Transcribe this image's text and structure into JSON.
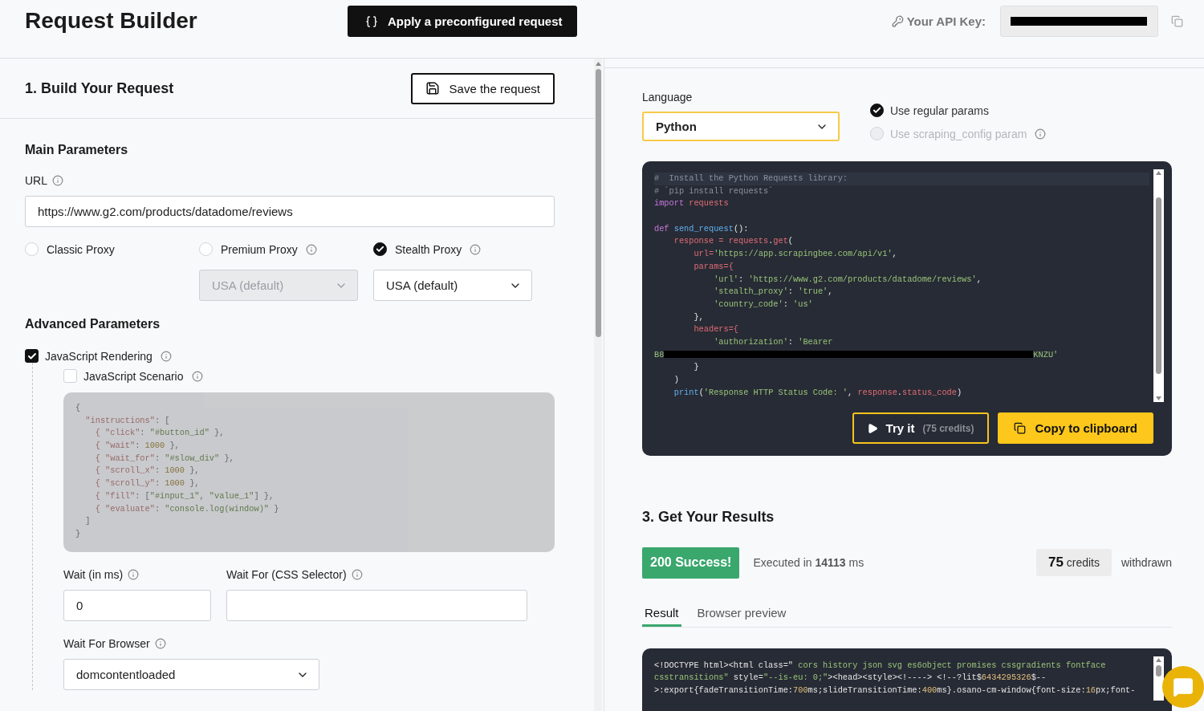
{
  "header": {
    "title": "Request Builder",
    "preset_button": "Apply a preconfigured request",
    "api_key_label": "Your API Key:"
  },
  "build": {
    "title": "1. Build Your Request",
    "save_button": "Save the request",
    "main": {
      "title": "Main Parameters",
      "url_label": "URL",
      "url_value": "https://www.g2.com/products/datadome/reviews",
      "proxies": [
        {
          "label": "Classic Proxy",
          "selected": false,
          "info": false
        },
        {
          "label": "Premium Proxy",
          "selected": false,
          "info": true,
          "country": "USA (default)"
        },
        {
          "label": "Stealth Proxy",
          "selected": true,
          "info": true,
          "country": "USA (default)"
        }
      ]
    },
    "advanced": {
      "title": "Advanced Parameters",
      "js_rendering": {
        "label": "JavaScript Rendering",
        "checked": true
      },
      "js_scenario": {
        "label": "JavaScript Scenario",
        "checked": false
      },
      "scenario_code": [
        {
          "kind": "code",
          "tokens": [
            {
              "text": "{",
              "kind": "plain"
            }
          ]
        },
        {
          "kind": "code",
          "tokens": [
            {
              "text": "  \"instructions\"",
              "kind": "key"
            },
            {
              "text": ": [",
              "kind": "plain"
            }
          ]
        },
        {
          "kind": "code",
          "tokens": [
            {
              "text": "    { \"click\"",
              "kind": "key"
            },
            {
              "text": ": ",
              "kind": "plain"
            },
            {
              "text": "\"#button_id\"",
              "kind": "string"
            },
            {
              "text": " },",
              "kind": "plain"
            }
          ]
        },
        {
          "kind": "code",
          "tokens": [
            {
              "text": "    { \"wait\"",
              "kind": "key"
            },
            {
              "text": ": ",
              "kind": "plain"
            },
            {
              "text": "1000",
              "kind": "number"
            },
            {
              "text": " },",
              "kind": "plain"
            }
          ]
        },
        {
          "kind": "code",
          "tokens": [
            {
              "text": "    { \"wait_for\"",
              "kind": "key"
            },
            {
              "text": ": ",
              "kind": "plain"
            },
            {
              "text": "\"#slow_div\"",
              "kind": "string"
            },
            {
              "text": " },",
              "kind": "plain"
            }
          ]
        },
        {
          "kind": "code",
          "tokens": [
            {
              "text": "    { \"scroll_x\"",
              "kind": "key"
            },
            {
              "text": ": ",
              "kind": "plain"
            },
            {
              "text": "1000",
              "kind": "number"
            },
            {
              "text": " },",
              "kind": "plain"
            }
          ]
        },
        {
          "kind": "code",
          "tokens": [
            {
              "text": "    { \"scroll_y\"",
              "kind": "key"
            },
            {
              "text": ": ",
              "kind": "plain"
            },
            {
              "text": "1000",
              "kind": "number"
            },
            {
              "text": " },",
              "kind": "plain"
            }
          ]
        },
        {
          "kind": "code",
          "tokens": [
            {
              "text": "    { \"fill\"",
              "kind": "key"
            },
            {
              "text": ": [",
              "kind": "plain"
            },
            {
              "text": "\"#input_1\"",
              "kind": "string"
            },
            {
              "text": ", ",
              "kind": "plain"
            },
            {
              "text": "\"value_1\"",
              "kind": "string"
            },
            {
              "text": "] },",
              "kind": "plain"
            }
          ]
        },
        {
          "kind": "code",
          "tokens": [
            {
              "text": "    { \"evaluate\"",
              "kind": "key"
            },
            {
              "text": ": ",
              "kind": "plain"
            },
            {
              "text": "\"console.log(window)\"",
              "kind": "string"
            },
            {
              "text": " }",
              "kind": "plain"
            }
          ]
        },
        {
          "kind": "code",
          "tokens": [
            {
              "text": "  ]",
              "kind": "plain"
            }
          ]
        },
        {
          "kind": "code",
          "tokens": [
            {
              "text": "}",
              "kind": "plain"
            }
          ]
        }
      ],
      "wait": {
        "label": "Wait (in ms)",
        "value": "0"
      },
      "wait_for": {
        "label": "Wait For (CSS Selector)"
      },
      "wait_for_browser": {
        "label": "Wait For Browser",
        "value": "domcontentloaded"
      }
    }
  },
  "code": {
    "language_label": "Language",
    "language": "Python",
    "param_modes": [
      {
        "label": "Use regular params",
        "selected": true,
        "disabled": false,
        "info": false
      },
      {
        "label": "Use scraping_config param",
        "selected": false,
        "disabled": true,
        "info": true
      }
    ],
    "lines": [
      {
        "kind": "code",
        "tokens": [
          {
            "text": "#  Install the Python Requests library:",
            "kind": "comment"
          }
        ]
      },
      {
        "kind": "code",
        "tokens": [
          {
            "text": "# `pip install requests`",
            "kind": "comment"
          }
        ]
      },
      {
        "kind": "code",
        "tokens": [
          {
            "text": "import",
            "kind": "keyword"
          },
          {
            "text": " requests",
            "kind": "variable"
          }
        ]
      },
      {
        "kind": "blank"
      },
      {
        "kind": "code",
        "tokens": [
          {
            "text": "def",
            "kind": "keyword"
          },
          {
            "text": " send_request",
            "kind": "function"
          },
          {
            "text": "():",
            "kind": "plain"
          }
        ]
      },
      {
        "kind": "code",
        "tokens": [
          {
            "text": "    response = requests",
            "kind": "variable"
          },
          {
            "text": ".",
            "kind": "plain"
          },
          {
            "text": "get",
            "kind": "variable"
          },
          {
            "text": "(",
            "kind": "plain"
          }
        ]
      },
      {
        "kind": "code",
        "tokens": [
          {
            "text": "        url=",
            "kind": "variable"
          },
          {
            "text": "'https://app.scrapingbee.com/api/v1'",
            "kind": "string"
          },
          {
            "text": ",",
            "kind": "plain"
          }
        ]
      },
      {
        "kind": "code",
        "tokens": [
          {
            "text": "        params={",
            "kind": "variable"
          }
        ]
      },
      {
        "kind": "code",
        "tokens": [
          {
            "text": "            'url'",
            "kind": "string"
          },
          {
            "text": ": ",
            "kind": "plain"
          },
          {
            "text": "'https://www.g2.com/products/datadome/reviews'",
            "kind": "string"
          },
          {
            "text": ",",
            "kind": "plain"
          }
        ]
      },
      {
        "kind": "code",
        "tokens": [
          {
            "text": "            'stealth_proxy'",
            "kind": "string"
          },
          {
            "text": ": ",
            "kind": "plain"
          },
          {
            "text": "'true'",
            "kind": "string"
          },
          {
            "text": ",",
            "kind": "plain"
          }
        ]
      },
      {
        "kind": "code",
        "tokens": [
          {
            "text": "            'country_code'",
            "kind": "string"
          },
          {
            "text": ": ",
            "kind": "plain"
          },
          {
            "text": "'us'",
            "kind": "string"
          }
        ]
      },
      {
        "kind": "code",
        "tokens": [
          {
            "text": "        },",
            "kind": "plain"
          }
        ]
      },
      {
        "kind": "code",
        "tokens": [
          {
            "text": "        headers={",
            "kind": "variable"
          }
        ]
      },
      {
        "kind": "code",
        "tokens": [
          {
            "text": "            'authorization'",
            "kind": "string"
          },
          {
            "text": ": ",
            "kind": "plain"
          },
          {
            "text": "'Bearer",
            "kind": "string"
          }
        ]
      },
      {
        "kind": "code",
        "tokens": [
          {
            "text": "B8",
            "kind": "string"
          },
          {
            "kind": "redacted"
          },
          {
            "text": "KNZU'",
            "kind": "string"
          }
        ]
      },
      {
        "kind": "code",
        "tokens": [
          {
            "text": "        }",
            "kind": "plain"
          }
        ]
      },
      {
        "kind": "code",
        "tokens": [
          {
            "text": "    )",
            "kind": "plain"
          }
        ]
      },
      {
        "kind": "code",
        "tokens": [
          {
            "text": "    print",
            "kind": "function"
          },
          {
            "text": "(",
            "kind": "plain"
          },
          {
            "text": "'Response HTTP Status Code: '",
            "kind": "string"
          },
          {
            "text": ", ",
            "kind": "plain"
          },
          {
            "text": "response",
            "kind": "variable"
          },
          {
            "text": ".",
            "kind": "plain"
          },
          {
            "text": "status_code",
            "kind": "variable"
          },
          {
            "text": ")",
            "kind": "plain"
          }
        ]
      }
    ],
    "try_button": {
      "label": "Try it",
      "credits": "(75 credits)"
    },
    "copy_button": "Copy to clipboard"
  },
  "results": {
    "title": "3. Get Your Results",
    "status": "200 Success!",
    "executed": "Executed in **14113** ms",
    "credits_value": "75",
    "credits_unit": "credits",
    "withdrawn": "withdrawn",
    "tabs": [
      {
        "label": "Result",
        "selected": true
      },
      {
        "label": "Browser preview",
        "selected": false
      }
    ],
    "lines": [
      {
        "kind": "code",
        "tokens": [
          {
            "text": "<!DOCTYPE html><html class=\"",
            "kind": "plain"
          },
          {
            "text": " cors history json svg es6object promises cssgradients fontface",
            "kind": "string"
          }
        ]
      },
      {
        "kind": "code",
        "tokens": [
          {
            "text": "csstransitions\"",
            "kind": "string"
          },
          {
            "text": " style=",
            "kind": "plain"
          },
          {
            "text": "\"--is-eu: 0;\"",
            "kind": "string"
          },
          {
            "text": "><head><style><!----> <!--?lit$",
            "kind": "plain"
          },
          {
            "text": "6434295326",
            "kind": "number"
          },
          {
            "text": "$--",
            "kind": "plain"
          }
        ]
      },
      {
        "kind": "code",
        "tokens": [
          {
            "text": ">:export{fadeTransitionTime:",
            "kind": "plain"
          },
          {
            "text": "700",
            "kind": "number"
          },
          {
            "text": "ms;slideTransitionTime:",
            "kind": "plain"
          },
          {
            "text": "400",
            "kind": "number"
          },
          {
            "text": "ms}.osano-cm-window{font-size:",
            "kind": "plain"
          },
          {
            "text": "16",
            "kind": "number"
          },
          {
            "text": "px;font-",
            "kind": "plain"
          }
        ]
      }
    ]
  }
}
